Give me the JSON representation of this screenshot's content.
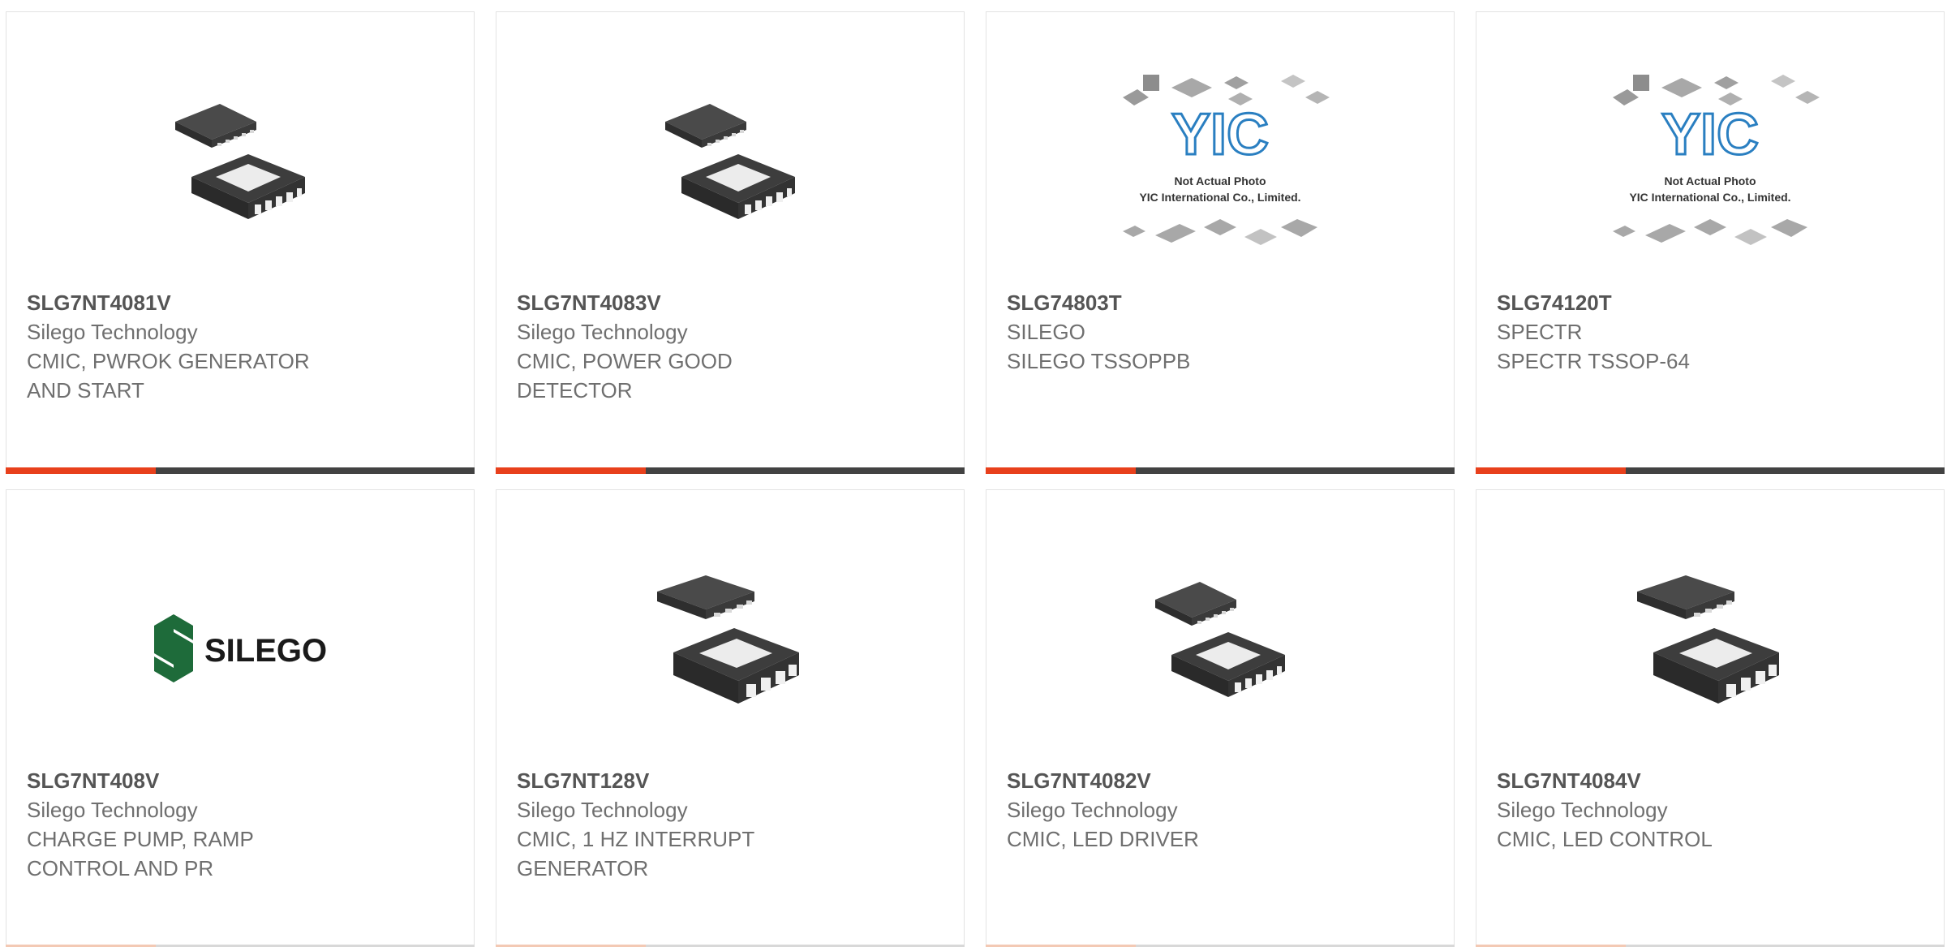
{
  "products": [
    {
      "part_number": "SLG7NT4081V",
      "manufacturer": "Silego Technology",
      "desc1": "CMIC, PWROK GENERATOR",
      "desc2": "AND START",
      "image": "dfn-12-chip-icon"
    },
    {
      "part_number": "SLG7NT4083V",
      "manufacturer": "Silego Technology",
      "desc1": "CMIC, POWER GOOD",
      "desc2": "DETECTOR",
      "image": "dfn-12-chip-icon"
    },
    {
      "part_number": "SLG74803T",
      "manufacturer": "SILEGO",
      "desc1": "SILEGO TSSOPPB",
      "desc2": "",
      "image": "yic-placeholder-image",
      "placeholder": {
        "logo": "YIC",
        "line1": "Not Actual Photo",
        "line2": "YIC International Co., Limited."
      }
    },
    {
      "part_number": "SLG74120T",
      "manufacturer": "SPECTR",
      "desc1": "SPECTR TSSOP-64",
      "desc2": "",
      "image": "yic-placeholder-image",
      "placeholder": {
        "logo": "YIC",
        "line1": "Not Actual Photo",
        "line2": "YIC International Co., Limited."
      }
    },
    {
      "part_number": "SLG7NT408V",
      "manufacturer": "Silego Technology",
      "desc1": "CHARGE PUMP, RAMP",
      "desc2": "CONTROL AND PR",
      "image": "silego-logo",
      "logo_text": "SILEGO"
    },
    {
      "part_number": "SLG7NT128V",
      "manufacturer": "Silego Technology",
      "desc1": "CMIC, 1 HZ INTERRUPT",
      "desc2": "GENERATOR",
      "image": "dfn-8-chip-icon"
    },
    {
      "part_number": "SLG7NT4082V",
      "manufacturer": "Silego Technology",
      "desc1": "CMIC, LED DRIVER",
      "desc2": "",
      "image": "dfn-12-chip-icon"
    },
    {
      "part_number": "SLG7NT4084V",
      "manufacturer": "Silego Technology",
      "desc1": "CMIC, LED CONTROL",
      "desc2": "",
      "image": "dfn-8-chip-icon"
    }
  ],
  "colors": {
    "accent": "#e8401c",
    "bar": "#424242",
    "text": "#6f6f6f",
    "logo_green": "#1e6b3a",
    "yic_blue": "#2a7fc1"
  }
}
